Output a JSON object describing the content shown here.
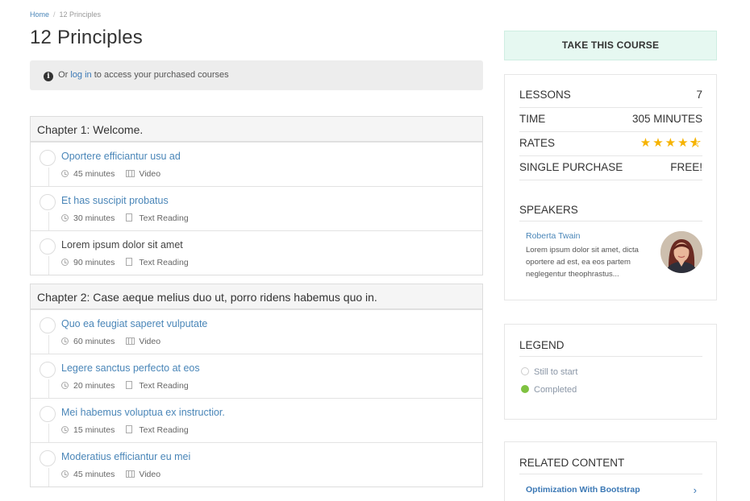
{
  "breadcrumb": {
    "home": "Home",
    "current": "12 Principles"
  },
  "page": {
    "title": "12 Principles"
  },
  "notice": {
    "prefix": "Or",
    "link": "log in",
    "suffix": "to access your purchased courses"
  },
  "chapters": [
    {
      "title": "Chapter 1: Welcome.",
      "lessons": [
        {
          "title": "Oportere efficiantur usu ad",
          "duration": "45 minutes",
          "type": "Video"
        },
        {
          "title": "Et has suscipit probatus",
          "duration": "30 minutes",
          "type": "Text Reading"
        },
        {
          "title": "Lorem ipsum dolor sit amet",
          "duration": "90 minutes",
          "type": "Text Reading"
        }
      ]
    },
    {
      "title": "Chapter 2: Case aeque melius duo ut, porro ridens habemus quo in.",
      "lessons": [
        {
          "title": "Quo ea feugiat saperet vulputate",
          "duration": "60 minutes",
          "type": "Video"
        },
        {
          "title": "Legere sanctus perfecto at eos",
          "duration": "20 minutes",
          "type": "Text Reading"
        },
        {
          "title": "Mei habemus voluptua ex instructior.",
          "duration": "15 minutes",
          "type": "Text Reading"
        },
        {
          "title": "Moderatius efficiantur eu mei",
          "duration": "45 minutes",
          "type": "Video"
        }
      ]
    }
  ],
  "sidebar": {
    "take_course": "TAKE THIS COURSE",
    "stats": {
      "lessons_label": "LESSONS",
      "lessons_value": "7",
      "time_label": "TIME",
      "time_value": "305 MINUTES",
      "rates_label": "RATES",
      "rating": 4.5,
      "purchase_label": "SINGLE PURCHASE",
      "purchase_value": "FREE!"
    },
    "speakers": {
      "title": "SPEAKERS",
      "name": "Roberta Twain",
      "bio": "Lorem ipsum dolor sit amet, dicta oportere ad est, ea eos partem neglegentur theophrastus..."
    },
    "legend": {
      "title": "LEGEND",
      "still_to_start": "Still to start",
      "completed": "Completed",
      "completed_color": "#7fc241"
    },
    "related": {
      "title": "RELATED CONTENT",
      "item": "Optimization With Bootstrap"
    }
  },
  "colors": {
    "link": "#4a86b8",
    "take_course_bg": "#e6f8f1",
    "star": "#f6b300"
  }
}
